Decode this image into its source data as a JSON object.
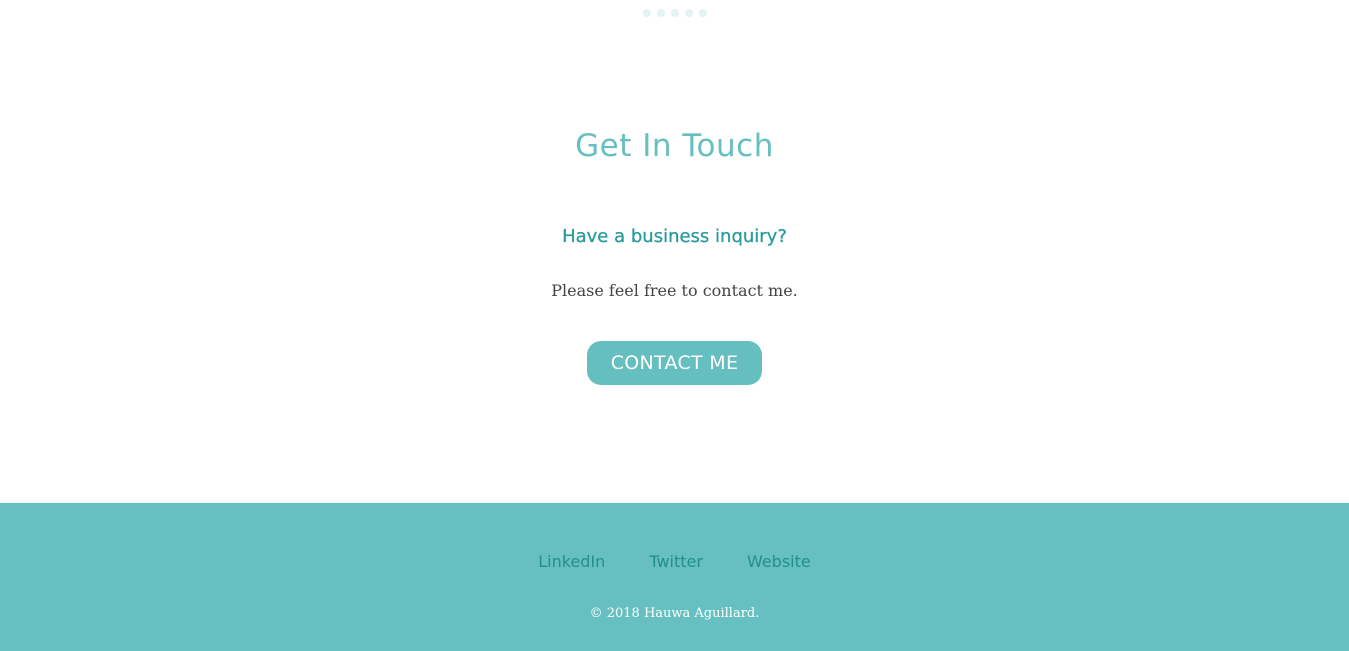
{
  "carousel": {
    "dot_count": 5,
    "dot_color": "#e3f3f3"
  },
  "contact": {
    "title": "Get In Touch",
    "subtitle": "Have a business inquiry?",
    "message": "Please feel free to contact me.",
    "button_label": "CONTACT ME"
  },
  "footer": {
    "links": [
      {
        "label": "LinkedIn"
      },
      {
        "label": "Twitter"
      },
      {
        "label": "Website"
      }
    ],
    "copyright": "© 2018 Hauwa Aguillard."
  },
  "colors": {
    "accent": "#65bec0",
    "heading": "#68bfc1",
    "subheading": "#2b9a9c",
    "footer_bg": "#66bfc0",
    "footer_link": "#238e90",
    "body_text": "#444444"
  }
}
